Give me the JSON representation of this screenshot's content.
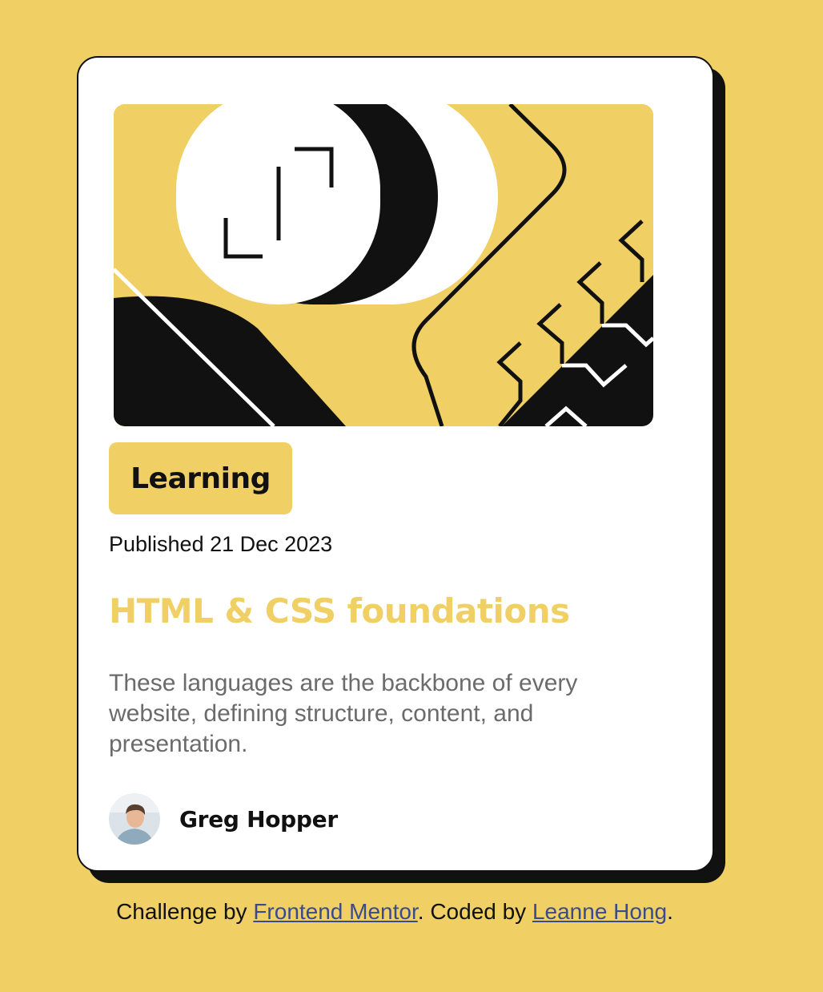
{
  "card": {
    "tag": "Learning",
    "published": "Published 21 Dec 2023",
    "title": "HTML & CSS foundations",
    "description": "These languages are the backbone of every website, defining structure, content, and presentation.",
    "author": {
      "name": "Greg Hopper",
      "avatar_icon": "person-avatar"
    },
    "hero_icon": "abstract-illustration"
  },
  "attribution": {
    "prefix": "Challenge by ",
    "link1": "Frontend Mentor",
    "middle": ". Coded by ",
    "link2": "Leanne Hong",
    "suffix": "."
  },
  "colors": {
    "background": "#F0D064",
    "accent": "#F0D064",
    "text": "#111111",
    "muted": "#6B6B6B",
    "link": "#3B4A8C",
    "card": "#FFFFFF"
  }
}
